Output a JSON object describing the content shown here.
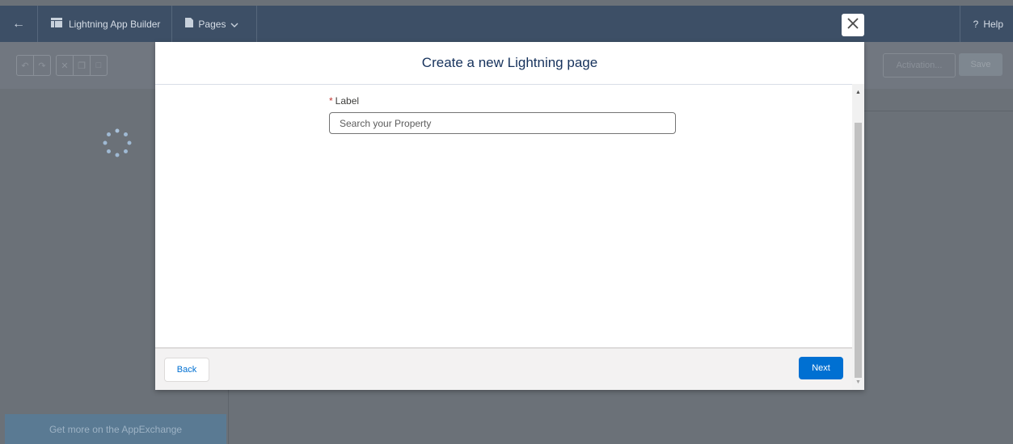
{
  "topbar": {
    "app_name": "Lightning App Builder",
    "pages_label": "Pages",
    "help_label": "Help"
  },
  "toolbar": {
    "activation_label": "Activation...",
    "save_label": "Save"
  },
  "left_panel": {
    "appexchange_label": "Get more on the AppExchange"
  },
  "modal": {
    "title": "Create a new Lightning page",
    "field": {
      "label": "Label",
      "required_marker": "*",
      "value": "",
      "placeholder": "Search your Property"
    },
    "back_label": "Back",
    "next_label": "Next"
  },
  "colors": {
    "header_bg": "#3d4f66",
    "brand_blue": "#0070d2",
    "overlay_gray": "#6b7178",
    "required_red": "#c23934"
  },
  "icons": [
    "back-arrow-icon",
    "app-builder-icon",
    "page-icon",
    "chevron-down-icon",
    "help-icon",
    "close-icon",
    "undo-icon",
    "redo-icon",
    "cut-icon",
    "copy-icon",
    "paste-icon",
    "loading-spinner-icon"
  ]
}
